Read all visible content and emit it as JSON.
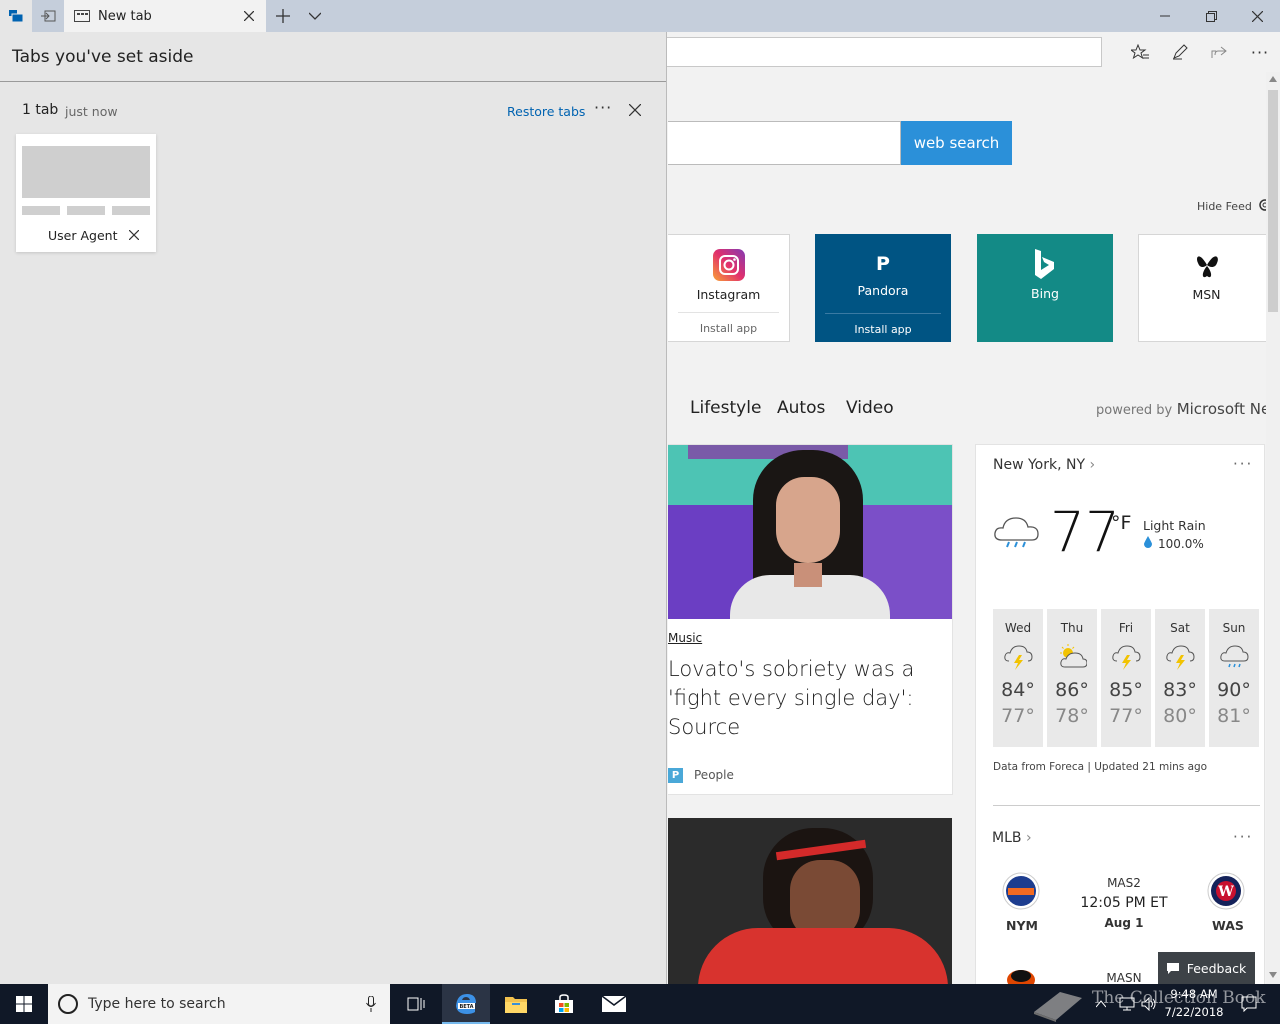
{
  "browser": {
    "tab_title": "New tab"
  },
  "panel": {
    "title": "Tabs you've set aside",
    "group_count": "1 tab",
    "group_time": "just now",
    "restore_label": "Restore tabs",
    "more_label": "···",
    "thumb_title": "User Agent"
  },
  "newtab": {
    "search_button": "web search",
    "hide_feed": "Hide Feed",
    "tiles": [
      {
        "name": "Instagram",
        "install": "Install app"
      },
      {
        "name": "Pandora",
        "install": "Install app",
        "glyph": "P"
      },
      {
        "name": "Bing"
      },
      {
        "name": "MSN"
      }
    ],
    "nav": [
      "Lifestyle",
      "Autos",
      "Video"
    ],
    "powered_by_prefix": "powered by",
    "powered_by_brand": "Microsoft New"
  },
  "news": {
    "category": "Music",
    "headline": "Lovato's sobriety was a 'fight every single day': Source",
    "source": "People"
  },
  "weather": {
    "location": "New York, NY",
    "temp": "77",
    "unit": "°F",
    "condition": "Light Rain",
    "precip": "100.0%",
    "days": [
      {
        "day": "Wed",
        "hi": "84°",
        "lo": "77°",
        "icon": "thunder-icon"
      },
      {
        "day": "Thu",
        "hi": "86°",
        "lo": "78°",
        "icon": "partly-sunny-icon"
      },
      {
        "day": "Fri",
        "hi": "85°",
        "lo": "77°",
        "icon": "thunder-icon"
      },
      {
        "day": "Sat",
        "hi": "83°",
        "lo": "80°",
        "icon": "thunder-icon"
      },
      {
        "day": "Sun",
        "hi": "90°",
        "lo": "81°",
        "icon": "rain-icon"
      }
    ],
    "footer": "Data from Foreca | Updated 21 mins ago"
  },
  "mlb": {
    "title": "MLB",
    "home": "NYM",
    "away": "WAS",
    "venue": "MAS2",
    "time": "12:05 PM ET",
    "date": "Aug 1",
    "next_venue": "MASN"
  },
  "feedback_label": "Feedback",
  "taskbar": {
    "search_placeholder": "Type here to search",
    "time": "9:48 AM",
    "date": "7/22/2018",
    "watermark": "The Collection Book"
  },
  "colors": {
    "accent": "#2b90d9",
    "pandora": "#005483",
    "bing": "#138a86",
    "restore_link": "#0063b1"
  }
}
